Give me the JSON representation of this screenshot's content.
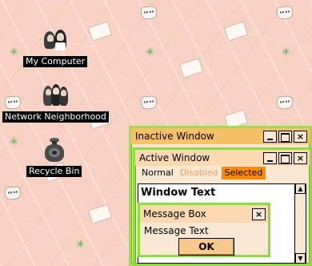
{
  "colors": {
    "desktop_background": "#f7d2c2",
    "inactive_title": "#f5c067",
    "window_border": "#8ddc3d",
    "selected_menu": "#ff8a00",
    "disabled_text": "#e2a56a",
    "window_background": "#fbe8d2"
  },
  "desktop_icons": [
    {
      "label": "My Computer",
      "icon": "computer-portrait-icon"
    },
    {
      "label": "Network Neighborhood",
      "icon": "network-portrait-icon"
    },
    {
      "label": "Recycle Bin",
      "icon": "recycle-sack-icon"
    }
  ],
  "inactive_window": {
    "title": "Inactive Window",
    "buttons": {
      "minimize": "_",
      "close": "×"
    }
  },
  "active_window": {
    "title": "Active Window",
    "buttons": {
      "minimize": "_",
      "close": "×"
    },
    "menu": {
      "normal": "Normal",
      "disabled": "Disabled",
      "selected": "Selected"
    },
    "window_text": "Window Text"
  },
  "message_box": {
    "title": "Message Box",
    "text": "Message Text",
    "ok": "OK",
    "close": "×"
  }
}
